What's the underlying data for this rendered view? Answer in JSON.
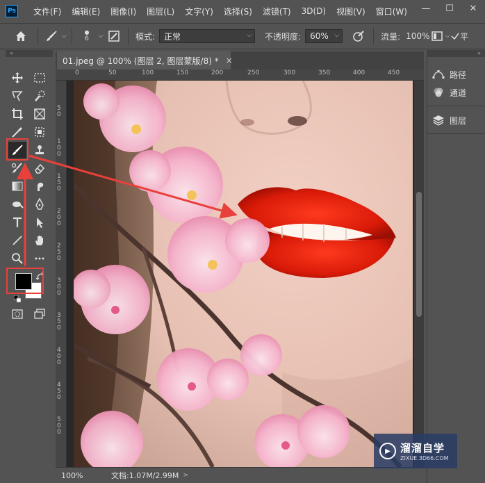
{
  "app": {
    "logo_text": "Ps"
  },
  "menu": [
    "文件(F)",
    "编辑(E)",
    "图像(I)",
    "图层(L)",
    "文字(Y)",
    "选择(S)",
    "滤镜(T)",
    "3D(D)",
    "视图(V)",
    "窗口(W)"
  ],
  "window_controls": {
    "minimize": "—",
    "maximize": "☐",
    "close": "✕"
  },
  "options": {
    "brush_size": "6",
    "mode_label": "模式:",
    "mode_value": "正常",
    "opacity_label": "不透明度:",
    "opacity_value": "60%",
    "flow_label": "流量:",
    "flow_value": "100%",
    "smooth_label": "平"
  },
  "document": {
    "tab_title": "01.jpeg @ 100% (图层 2, 图层蒙版/8) *",
    "close": "×",
    "ruler_top": [
      "0",
      "50",
      "100",
      "150",
      "200",
      "250",
      "300",
      "350",
      "400",
      "450"
    ],
    "ruler_left": [
      "5\n0",
      "1\n0\n0",
      "1\n5\n0",
      "2\n0\n0",
      "2\n5\n0",
      "3\n0\n0",
      "3\n5\n0",
      "4\n0\n0",
      "4\n5\n0",
      "5\n0\n0"
    ]
  },
  "status": {
    "zoom": "100%",
    "doc_info": "文档:1.07M/2.99M",
    "arrow": ">"
  },
  "panels": [
    {
      "label": "路径",
      "icon": "paths-icon"
    },
    {
      "label": "通道",
      "icon": "channels-icon"
    },
    {
      "label": "图层",
      "icon": "layers-icon"
    }
  ],
  "watermark": {
    "title": "溜溜自学",
    "url": "ZIXUE.3D66.COM"
  },
  "colors": {
    "annotation_red": "#e8413c",
    "panel_bg": "#535353",
    "lip_red": "#d41a0a",
    "blossom_pink": "#f2a9c4"
  }
}
